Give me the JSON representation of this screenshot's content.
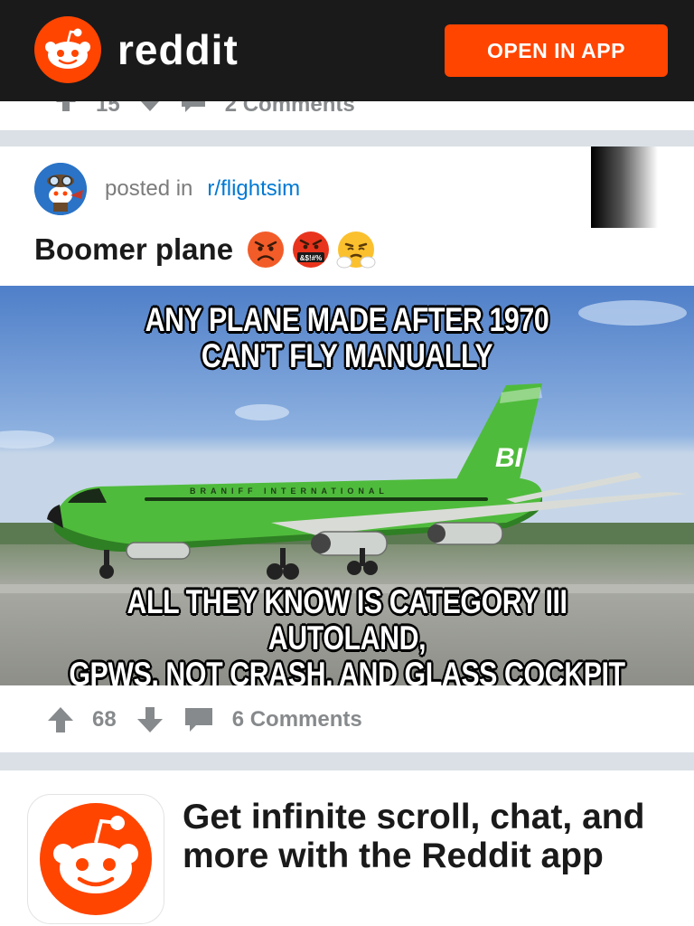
{
  "header": {
    "brand": "reddit",
    "open_app_label": "OPEN IN APP",
    "accent_color": "#ff4500",
    "background_color": "#1a1a1b"
  },
  "previous_post": {
    "score": "15",
    "comments_label": "2 Comments"
  },
  "post": {
    "posted_in_label": "posted in",
    "subreddit": "r/flightsim",
    "title": "Boomer plane",
    "title_emojis": [
      "angry-face-icon",
      "cursing-face-icon",
      "steam-from-nose-face-icon"
    ],
    "cursing_symbols": "&$!#%",
    "meme": {
      "top_line_1": "ANY PLANE MADE AFTER 1970",
      "top_line_2": "CAN'T FLY MANUALLY",
      "bottom_line_1": "ALL THEY KNOW IS CATEGORY III AUTOLAND,",
      "bottom_line_2": "GPWS, NOT CRASH, AND GLASS COCKPIT",
      "tail_code": "BI",
      "fuselage_text": "BRANIFF INTERNATIONAL"
    },
    "score": "68",
    "comments_label": "6 Comments"
  },
  "promo": {
    "text": "Get infinite scroll, chat, and more with the Reddit app"
  }
}
